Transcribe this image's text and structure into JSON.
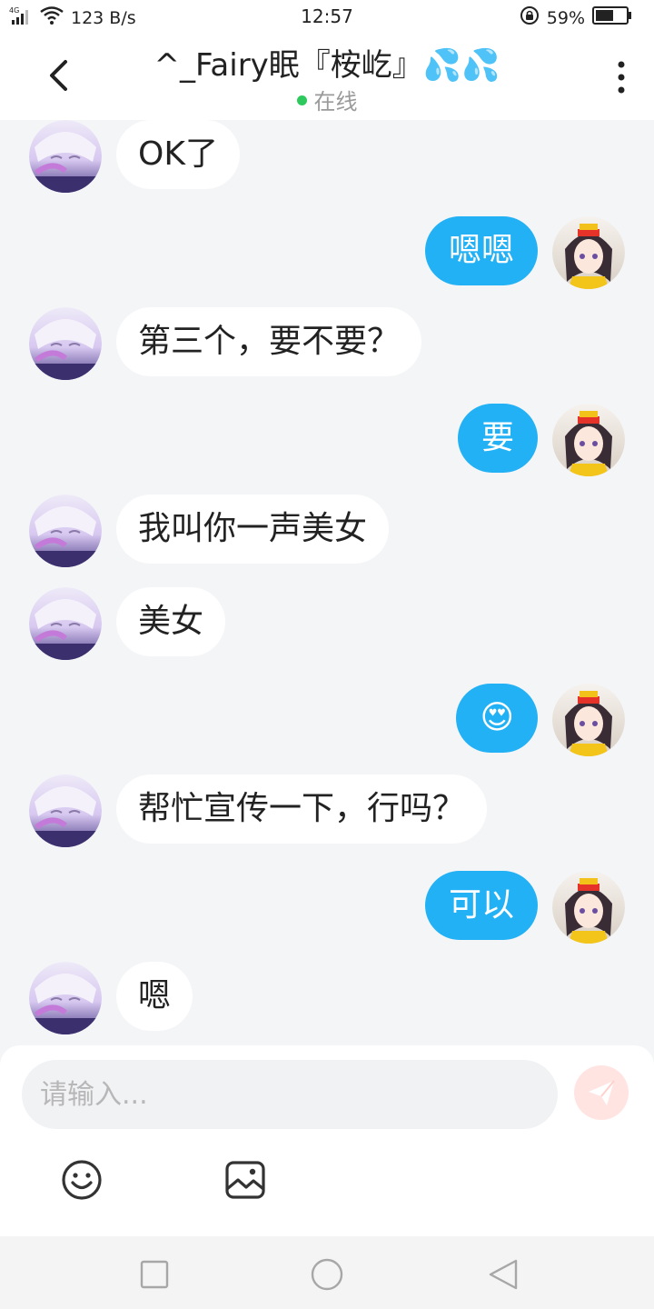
{
  "status_bar": {
    "network": "4G",
    "speed": "123 B/s",
    "time": "12:57",
    "battery": "59%"
  },
  "header": {
    "title": "^_Fairy眠『桉屹』💦💦",
    "status": "在线"
  },
  "messages": [
    {
      "side": "in",
      "text": "OK了"
    },
    {
      "side": "out",
      "text": "嗯嗯"
    },
    {
      "side": "in",
      "text": "第三个，要不要？"
    },
    {
      "side": "out",
      "text": "要"
    },
    {
      "side": "in",
      "text": "我叫你一声美女"
    },
    {
      "side": "in",
      "text": "美女"
    },
    {
      "side": "out",
      "text": "😍"
    },
    {
      "side": "in",
      "text": "帮忙宣传一下，行吗？"
    },
    {
      "side": "out",
      "text": "可以"
    },
    {
      "side": "in",
      "text": "嗯"
    }
  ],
  "composer": {
    "placeholder": "请输入..."
  },
  "colors": {
    "outgoing_bubble": "#23b1f5",
    "incoming_bubble": "#ffffff",
    "online_dot": "#2ec95c",
    "send_button": "#ffe4e2",
    "background": "#f4f5f7"
  },
  "icons": {
    "back": "chevron-left-icon",
    "more": "more-vertical-icon",
    "emoji": "smiley-icon",
    "image": "image-icon",
    "send": "paper-plane-icon",
    "nav_recents": "square-icon",
    "nav_home": "circle-icon",
    "nav_back": "triangle-back-icon"
  }
}
